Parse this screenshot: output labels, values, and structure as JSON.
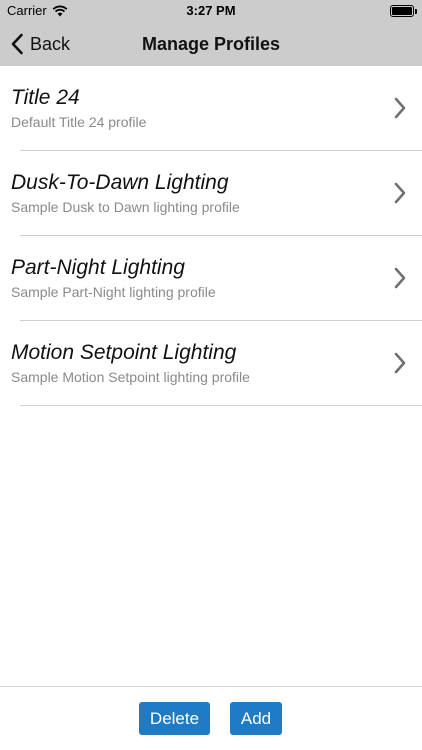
{
  "status": {
    "carrier": "Carrier",
    "time": "3:27 PM",
    "battery_level": 1.0
  },
  "nav": {
    "back_label": "Back",
    "title": "Manage Profiles"
  },
  "profiles": [
    {
      "title": "Title 24",
      "subtitle": "Default Title 24 profile"
    },
    {
      "title": "Dusk-To-Dawn Lighting",
      "subtitle": "Sample Dusk to Dawn lighting profile"
    },
    {
      "title": "Part-Night Lighting",
      "subtitle": "Sample Part-Night lighting profile"
    },
    {
      "title": "Motion Setpoint Lighting",
      "subtitle": "Sample Motion Setpoint lighting profile"
    }
  ],
  "toolbar": {
    "delete_label": "Delete",
    "add_label": "Add"
  },
  "colors": {
    "bar_background": "#cccccc",
    "button_blue": "#1f7cc4",
    "subtitle_gray": "#8a8a8a"
  }
}
